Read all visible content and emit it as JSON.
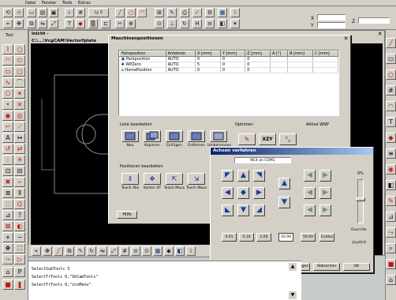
{
  "menu": {
    "items": [
      "Datei",
      "Fenster",
      "Tools",
      "Extras"
    ]
  },
  "top_toolbar": {
    "xyz_labels": [
      "X",
      "Y",
      "Z"
    ],
    "layer_label": "Ly 0"
  },
  "cam_window": {
    "tab_label": "Tool",
    "title": "inicht - C:\\...\\VcgCAM\\Vectorfplate"
  },
  "machine_dialog": {
    "title": "Maschinenpositionen",
    "columns": [
      "Fahrposition",
      "Anfahren",
      "X [mm]",
      "Y [mm]",
      "Z [mm]",
      "A [°]",
      "B [mm]",
      "C [mm]"
    ],
    "rows": [
      {
        "name": "Parkposition",
        "mode": "AUTO",
        "x": "0",
        "y": "0",
        "z": "0"
      },
      {
        "name": "WPZero",
        "mode": "AUTO",
        "x": "5",
        "y": "0",
        "z": "0"
      },
      {
        "name": "HomePosition",
        "mode": "AUTO",
        "x": "0",
        "y": "0",
        "z": "0"
      }
    ],
    "list_group": "Liste bearbeiten",
    "list_buttons": [
      "Neu",
      "Kopieren",
      "Einfügen",
      "Entfernen",
      "Umbenennen"
    ],
    "options_group": "Optionen",
    "options_buttons": [
      "XZY"
    ],
    "active_label": "Aktive WNP",
    "pos_group": "Positionen bearbeiten",
    "pos_buttons": [
      "Teach Alle",
      "Karten XY",
      "Teach Maus",
      "Teach Maus",
      "Teach Z"
    ],
    "help_button": "Hilfe"
  },
  "jog_dialog": {
    "title": "Achsen verfahren",
    "port": "NC4 an COM1",
    "percent": "0%",
    "override_label": "Override",
    "joystick_label": "Joystick",
    "steps": [
      "0.01",
      "0.10",
      "1.00",
      "10.00",
      "50.00",
      "Endlos"
    ],
    "selected_step": "10.00",
    "buttons": [
      "Einstellungen",
      "Abbrechen",
      "OK"
    ]
  },
  "console": {
    "lines": [
      "SelectSubTools 3",
      "SelectTrTools 0,\"ShCamTools\"",
      "SelectTrTools 0,\"insMenu\""
    ]
  }
}
